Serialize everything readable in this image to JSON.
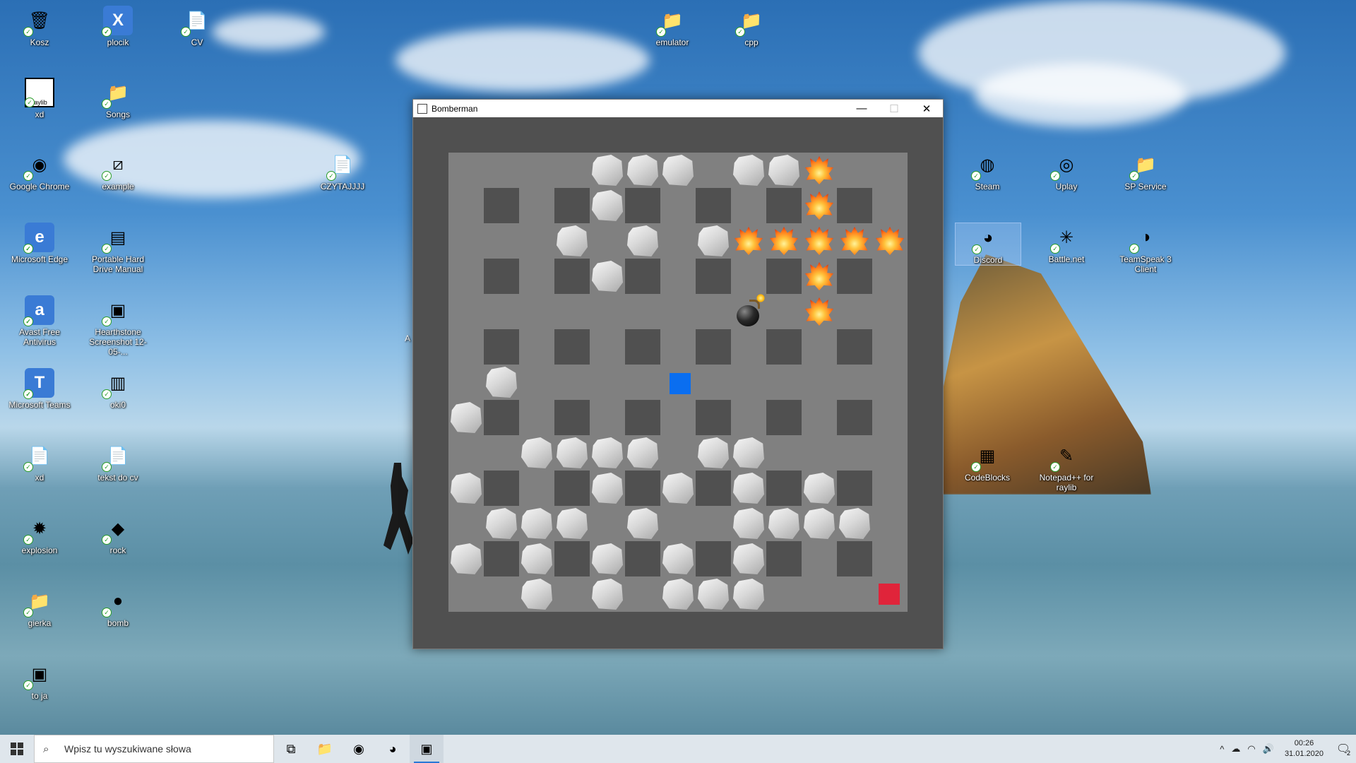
{
  "desktop": {
    "icons": [
      {
        "label": "Kosz",
        "icon": "recycle-bin-icon",
        "glyph": "🗑"
      },
      {
        "label": "plocik",
        "icon": "excel-file-icon",
        "glyph": "X"
      },
      {
        "label": "CV",
        "icon": "document-icon",
        "glyph": "📄"
      },
      {
        "label": "xd",
        "icon": "raylib-icon",
        "glyph": "raylib"
      },
      {
        "label": "Songs",
        "icon": "folder-icon",
        "glyph": "📁"
      },
      {
        "label": "Google Chrome",
        "icon": "chrome-icon",
        "glyph": "◉"
      },
      {
        "label": "example",
        "icon": "file-icon",
        "glyph": "⧄"
      },
      {
        "label": "CZYTAJJJJ",
        "icon": "text-file-icon",
        "glyph": "📄"
      },
      {
        "label": "Microsoft Edge",
        "icon": "edge-icon",
        "glyph": "e"
      },
      {
        "label": "Portable Hard Drive Manual",
        "icon": "pdf-icon",
        "glyph": "▤"
      },
      {
        "label": "Avast Free Antivirus",
        "icon": "avast-icon",
        "glyph": "a"
      },
      {
        "label": "Hearthstone Screenshot 12-05-...",
        "icon": "image-icon",
        "glyph": "▣"
      },
      {
        "label": "Microsoft Teams",
        "icon": "teams-icon",
        "glyph": "T"
      },
      {
        "label": "oki0",
        "icon": "winrar-icon",
        "glyph": "▥"
      },
      {
        "label": "xd",
        "icon": "image-file-icon",
        "glyph": "📄"
      },
      {
        "label": "tekst do cv",
        "icon": "text-file-icon",
        "glyph": "📄"
      },
      {
        "label": "explosion",
        "icon": "explosion-image-icon",
        "glyph": "✹"
      },
      {
        "label": "rock",
        "icon": "rock-image-icon",
        "glyph": "◆"
      },
      {
        "label": "gierka",
        "icon": "zip-folder-icon",
        "glyph": "📁"
      },
      {
        "label": "bomb",
        "icon": "bomb-image-icon",
        "glyph": "●"
      },
      {
        "label": "to ja",
        "icon": "photo-icon",
        "glyph": "▣"
      },
      {
        "label": "emulator",
        "icon": "folder-icon",
        "glyph": "📁"
      },
      {
        "label": "cpp",
        "icon": "folder-icon",
        "glyph": "📁"
      },
      {
        "label": "Steam",
        "icon": "steam-icon",
        "glyph": "◍"
      },
      {
        "label": "Uplay",
        "icon": "uplay-icon",
        "glyph": "◎"
      },
      {
        "label": "SP Service",
        "icon": "folder-icon",
        "glyph": "📁"
      },
      {
        "label": "Discord",
        "icon": "discord-icon",
        "glyph": "◕"
      },
      {
        "label": "Battle.net",
        "icon": "battlenet-icon",
        "glyph": "✳"
      },
      {
        "label": "TeamSpeak 3 Client",
        "icon": "teamspeak-icon",
        "glyph": "◑"
      },
      {
        "label": "CodeBlocks",
        "icon": "codeblocks-icon",
        "glyph": "▦"
      },
      {
        "label": "Notepad++ for raylib",
        "icon": "notepadpp-icon",
        "glyph": "✎"
      }
    ],
    "partial_label": "A"
  },
  "window": {
    "title": "Bomberman",
    "minimize_glyph": "—",
    "maximize_glyph": "☐",
    "close_glyph": "✕",
    "game": {
      "grid_cols": 13,
      "grid_rows": 13,
      "colors": {
        "border": "#505050",
        "floor": "#808080",
        "wall": "#505050",
        "player": "#0a6ef0",
        "enemy": "#e0243a"
      },
      "walls_note": "indestructible walls at odd row & odd col (0-indexed)",
      "rocks": [
        [
          0,
          4
        ],
        [
          0,
          5
        ],
        [
          0,
          6
        ],
        [
          0,
          8
        ],
        [
          0,
          9
        ],
        [
          1,
          4
        ],
        [
          2,
          3
        ],
        [
          2,
          5
        ],
        [
          2,
          7
        ],
        [
          3,
          4
        ],
        [
          6,
          1
        ],
        [
          7,
          0
        ],
        [
          8,
          2
        ],
        [
          8,
          3
        ],
        [
          8,
          4
        ],
        [
          8,
          5
        ],
        [
          8,
          7
        ],
        [
          8,
          8
        ],
        [
          9,
          0
        ],
        [
          9,
          4
        ],
        [
          9,
          6
        ],
        [
          9,
          8
        ],
        [
          9,
          10
        ],
        [
          10,
          1
        ],
        [
          10,
          2
        ],
        [
          10,
          3
        ],
        [
          10,
          5
        ],
        [
          10,
          8
        ],
        [
          10,
          9
        ],
        [
          10,
          10
        ],
        [
          10,
          11
        ],
        [
          11,
          0
        ],
        [
          11,
          2
        ],
        [
          11,
          4
        ],
        [
          11,
          6
        ],
        [
          11,
          8
        ],
        [
          12,
          2
        ],
        [
          12,
          4
        ],
        [
          12,
          6
        ],
        [
          12,
          7
        ],
        [
          12,
          8
        ]
      ],
      "fires": [
        [
          0,
          10
        ],
        [
          1,
          10
        ],
        [
          2,
          8
        ],
        [
          2,
          9
        ],
        [
          2,
          10
        ],
        [
          2,
          11
        ],
        [
          2,
          12
        ],
        [
          3,
          10
        ],
        [
          4,
          10
        ]
      ],
      "bomb": [
        4,
        8
      ],
      "player": [
        6,
        6
      ],
      "enemy": [
        12,
        12
      ]
    }
  },
  "taskbar": {
    "search_placeholder": "Wpisz tu wyszukiwane słowa",
    "apps": [
      {
        "name": "task-view",
        "glyph": "⧉"
      },
      {
        "name": "file-explorer",
        "glyph": "📁"
      },
      {
        "name": "chrome",
        "glyph": "◉"
      },
      {
        "name": "discord",
        "glyph": "◕"
      },
      {
        "name": "raylib",
        "glyph": "▣"
      }
    ],
    "tray": {
      "chevron": "^",
      "onedrive": "☁",
      "wifi": "◠",
      "volume": "🔊",
      "time": "00:26",
      "date": "31.01.2020",
      "notification_count": "2"
    }
  }
}
